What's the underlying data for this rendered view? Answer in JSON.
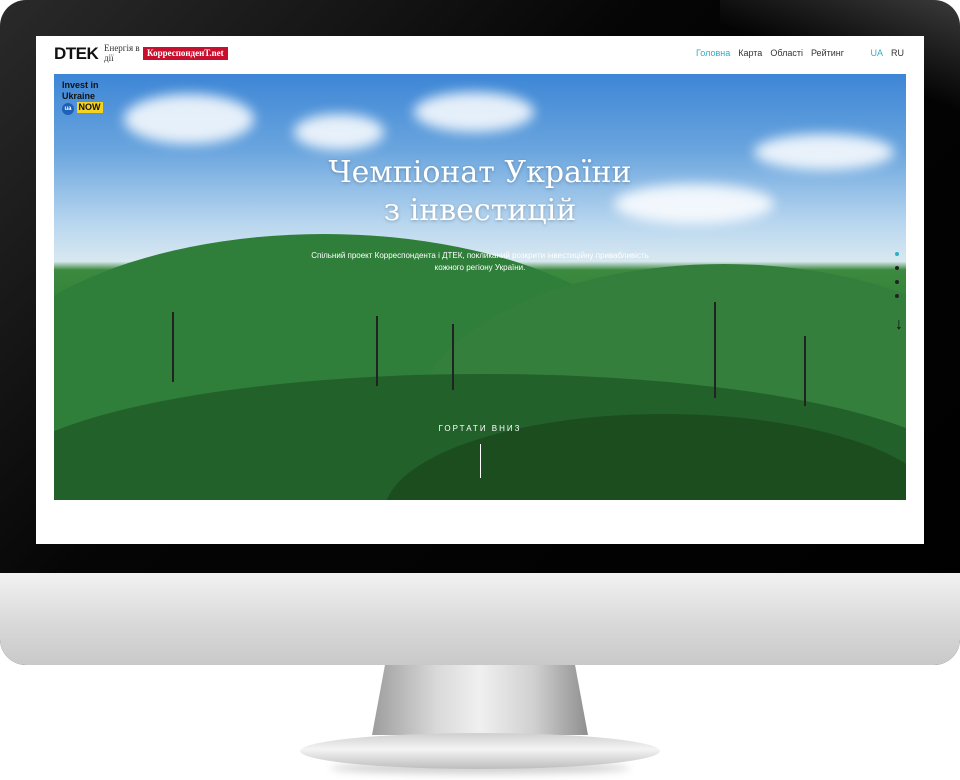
{
  "header": {
    "logo_text": "DTEK",
    "tagline": "Енергія в дії",
    "partner_logo_text": "КорреспонденТ.net",
    "nav": [
      "Головна",
      "Карта",
      "Області",
      "Рейтинг"
    ],
    "nav_active_index": 0,
    "langs": [
      "UA",
      "RU"
    ],
    "lang_active_index": 0
  },
  "hero": {
    "badge_line1": "Invest in",
    "badge_line2": "Ukraine",
    "badge_now": "NOW",
    "badge_ua": "ua",
    "title_line1": "Чемпіонат України",
    "title_line2": "з інвестицій",
    "subtitle": "Спільний проект Корреспондента і ДТЕК, покликаний розкрити інвестиційну привабливість кожного регіону України.",
    "scroll_label": "ГОРТАТИ ВНИЗ"
  },
  "side_nav": {
    "dots": 4,
    "active_index": 0,
    "arrow": "↓"
  },
  "colors": {
    "accent": "#2ab0c6",
    "korr_red": "#c8102e",
    "badge_yellow": "#f5d21f"
  }
}
